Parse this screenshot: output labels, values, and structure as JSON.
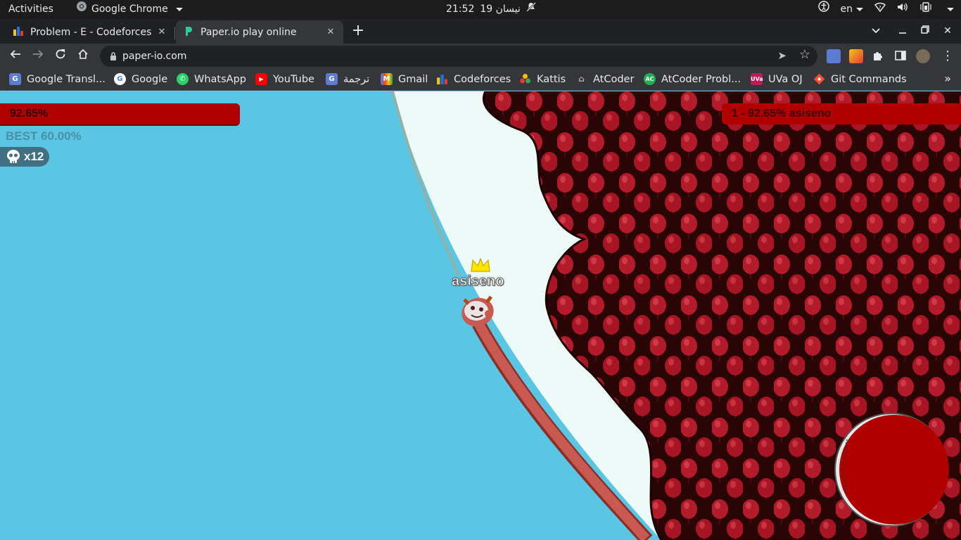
{
  "system_bar": {
    "activities": "Activities",
    "app_name": "Google Chrome",
    "date": "19 نيسان",
    "time": "21:52",
    "language": "en"
  },
  "tabs": [
    {
      "title": "Problem - E - Codeforces",
      "icon": "codeforces-icon",
      "active": false
    },
    {
      "title": "Paper.io play online",
      "icon": "paperio-icon",
      "active": true
    }
  ],
  "address_bar": {
    "url": "paper-io.com"
  },
  "bookmarks": [
    {
      "label": "Google Transl...",
      "icon": "google-translate-icon"
    },
    {
      "label": "Google",
      "icon": "google-icon"
    },
    {
      "label": "WhatsApp",
      "icon": "whatsapp-icon"
    },
    {
      "label": "YouTube",
      "icon": "youtube-icon"
    },
    {
      "label": "ترجمة",
      "icon": "google-translate-icon"
    },
    {
      "label": "Gmail",
      "icon": "gmail-icon"
    },
    {
      "label": "Codeforces",
      "icon": "codeforces-icon"
    },
    {
      "label": "Kattis",
      "icon": "kattis-icon"
    },
    {
      "label": "AtCoder",
      "icon": "atcoder-icon"
    },
    {
      "label": "AtCoder Probl...",
      "icon": "atcoder-problems-icon"
    },
    {
      "label": "UVa OJ",
      "icon": "uva-icon"
    },
    {
      "label": "Git Commands",
      "icon": "git-icon"
    }
  ],
  "game": {
    "territory_percent": "92.65%",
    "best": "BEST 60.00%",
    "kills": "x12",
    "leaderboard": [
      "1 - 92.65% asiseno"
    ],
    "player_name": "asiseno",
    "colors": {
      "background": "#5bc6e4",
      "player_territory": "#b00000",
      "trail": "#c85a52",
      "snow": "#eefaf8"
    }
  }
}
